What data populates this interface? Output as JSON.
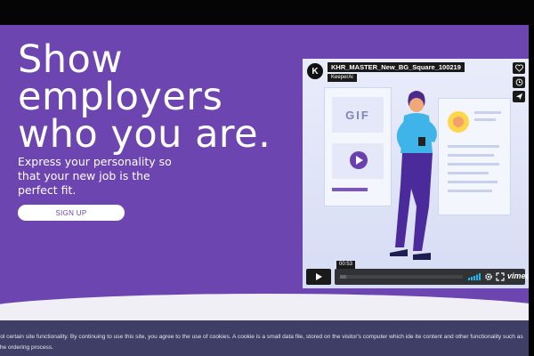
{
  "hero": {
    "title": "Show employers who you are.",
    "subtitle": "Express your personality so that your new job is the perfect fit.",
    "signup_label": "SIGN UP"
  },
  "video": {
    "logo_letter": "K",
    "title": "KHR_MASTER_New_BG_Square_100219",
    "channel": "KeeperAi",
    "gif_label": "GIF",
    "time": "00:53",
    "progress": 0.05,
    "brand": "vimeo",
    "side_icons": [
      "heart-icon",
      "clock-icon",
      "send-icon"
    ]
  },
  "cookie": {
    "text": "rol certain site functionality. By continuing to use this site, you agree to the use of cookies. A cookie is a small data file, stored on the visitor's computer which ide ite content and other functionality such as the ordering process."
  },
  "colors": {
    "hero_bg": "#6c45b0",
    "cookie_bg": "#3e3e66",
    "wave": "#f1eff6",
    "accent": "#7c54c4"
  }
}
